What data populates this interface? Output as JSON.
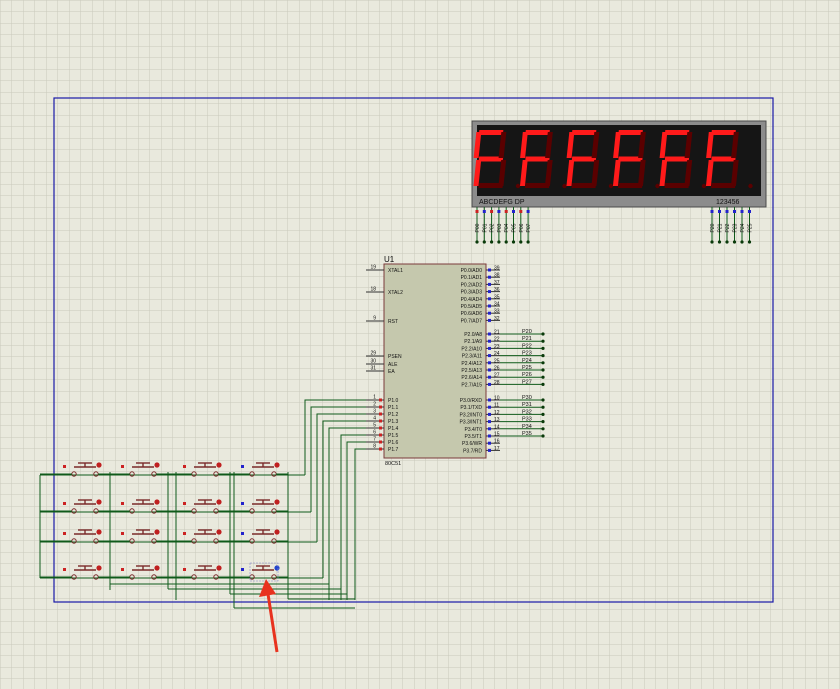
{
  "colors": {
    "background": "#e9e9dd",
    "grid": "#c9c9bb",
    "frame": "#1a1aa8",
    "ic_body": "#c5c8ad",
    "wire": "#0f5a1a",
    "pin_red": "#cc2222",
    "pin_blue": "#2222cc",
    "segment_on": "#ff1a1a",
    "segment_off": "#5a0000",
    "arrow": "#e8321e"
  },
  "ic": {
    "ref": "U1",
    "part": "80C51",
    "left_pins": [
      {
        "num": "19",
        "label": "XTAL1"
      },
      {
        "num": "18",
        "label": "XTAL2"
      },
      {
        "num": "9",
        "label": "RST"
      },
      {
        "num": "29",
        "label": "PSEN"
      },
      {
        "num": "30",
        "label": "ALE"
      },
      {
        "num": "31",
        "label": "EA"
      },
      {
        "num": "1",
        "label": "P1.0"
      },
      {
        "num": "2",
        "label": "P1.1"
      },
      {
        "num": "3",
        "label": "P1.2"
      },
      {
        "num": "4",
        "label": "P1.3"
      },
      {
        "num": "5",
        "label": "P1.4"
      },
      {
        "num": "6",
        "label": "P1.5"
      },
      {
        "num": "7",
        "label": "P1.6"
      },
      {
        "num": "8",
        "label": "P1.7"
      }
    ],
    "right_pins_p0": [
      {
        "num": "39",
        "label": "P0.0/AD0"
      },
      {
        "num": "38",
        "label": "P0.1/AD1"
      },
      {
        "num": "37",
        "label": "P0.2/AD2"
      },
      {
        "num": "36",
        "label": "P0.3/AD3"
      },
      {
        "num": "35",
        "label": "P0.4/AD4"
      },
      {
        "num": "34",
        "label": "P0.5/AD5"
      },
      {
        "num": "33",
        "label": "P0.6/AD6"
      },
      {
        "num": "32",
        "label": "P0.7/AD7"
      }
    ],
    "right_pins_p2": [
      {
        "num": "21",
        "label": "P2.0/A8",
        "net": "P20"
      },
      {
        "num": "22",
        "label": "P2.1/A9",
        "net": "P21"
      },
      {
        "num": "23",
        "label": "P2.2/A10",
        "net": "P22"
      },
      {
        "num": "24",
        "label": "P2.3/A11",
        "net": "P23"
      },
      {
        "num": "25",
        "label": "P2.4/A12",
        "net": "P24"
      },
      {
        "num": "26",
        "label": "P2.5/A13",
        "net": "P25"
      },
      {
        "num": "27",
        "label": "P2.6/A14",
        "net": "P26"
      },
      {
        "num": "28",
        "label": "P2.7/A15",
        "net": "P27"
      }
    ],
    "right_pins_p3": [
      {
        "num": "10",
        "label": "P3.0/RXD",
        "net": "P30"
      },
      {
        "num": "11",
        "label": "P3.1/TXD",
        "net": "P31"
      },
      {
        "num": "12",
        "label": "P3.2/INT0",
        "net": "P32"
      },
      {
        "num": "13",
        "label": "P3.3/INT1",
        "net": "P33"
      },
      {
        "num": "14",
        "label": "P3.4/T0",
        "net": "P34"
      },
      {
        "num": "15",
        "label": "P3.5/T1",
        "net": "P35"
      },
      {
        "num": "16",
        "label": "P3.6/WR",
        "net": ""
      },
      {
        "num": "17",
        "label": "P3.7/RD",
        "net": ""
      }
    ]
  },
  "display": {
    "digits": [
      "F",
      "F",
      "F",
      "F",
      "F",
      "F"
    ],
    "segment_label": "ABCDEFG DP",
    "digit_select_label": "123456",
    "segment_pins": [
      "P00",
      "P01",
      "P02",
      "P03",
      "P04",
      "P05",
      "P06",
      "P07"
    ],
    "select_pins": [
      "P20",
      "P21",
      "P22",
      "P23",
      "P24",
      "P25"
    ]
  },
  "keypad": {
    "rows": 4,
    "cols": 4,
    "highlighted_key": "row 4, col 4"
  }
}
